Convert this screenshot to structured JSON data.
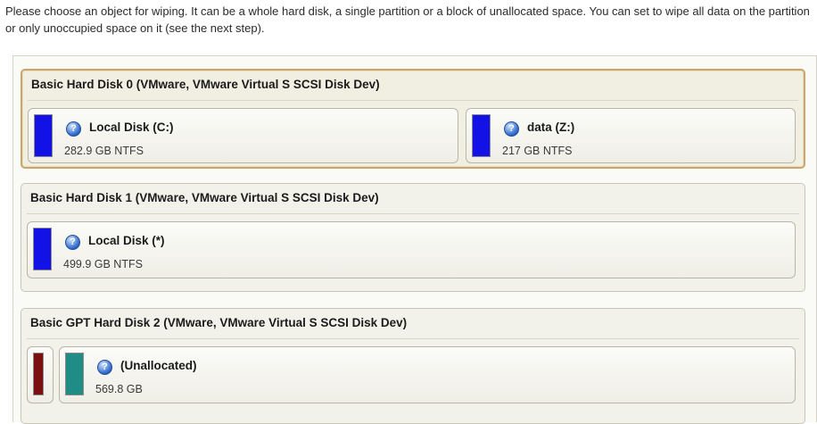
{
  "instructions": "Please choose an object for wiping. It can be a whole hard disk, a single partition or a block of unallocated space. You can set to wipe all data on the partition or only unoccupied space on it (see the next step).",
  "colors": {
    "partition_ntfs": "#1212e6",
    "unallocated": "#1f8d86",
    "reserved": "#7a1010",
    "selected_border": "#c9a66b"
  },
  "disks": [
    {
      "title": "Basic Hard Disk 0 (VMware, VMware Virtual S SCSI Disk Dev)",
      "selected": true,
      "partitions": [
        {
          "name": "Local Disk (C:)",
          "info": "282.9 GB NTFS",
          "icon": "help-icon"
        },
        {
          "name": "data (Z:)",
          "info": "217 GB NTFS",
          "icon": "help-icon"
        }
      ]
    },
    {
      "title": "Basic Hard Disk 1 (VMware, VMware Virtual S SCSI Disk Dev)",
      "selected": false,
      "partitions": [
        {
          "name": "Local Disk (*)",
          "info": "499.9 GB NTFS",
          "icon": "help-icon"
        }
      ]
    },
    {
      "title": "Basic GPT Hard Disk 2 (VMware, VMware Virtual S SCSI Disk Dev)",
      "selected": false,
      "partitions": [
        {
          "name": "(Unallocated)",
          "info": "569.8 GB",
          "icon": "help-icon"
        }
      ]
    }
  ]
}
